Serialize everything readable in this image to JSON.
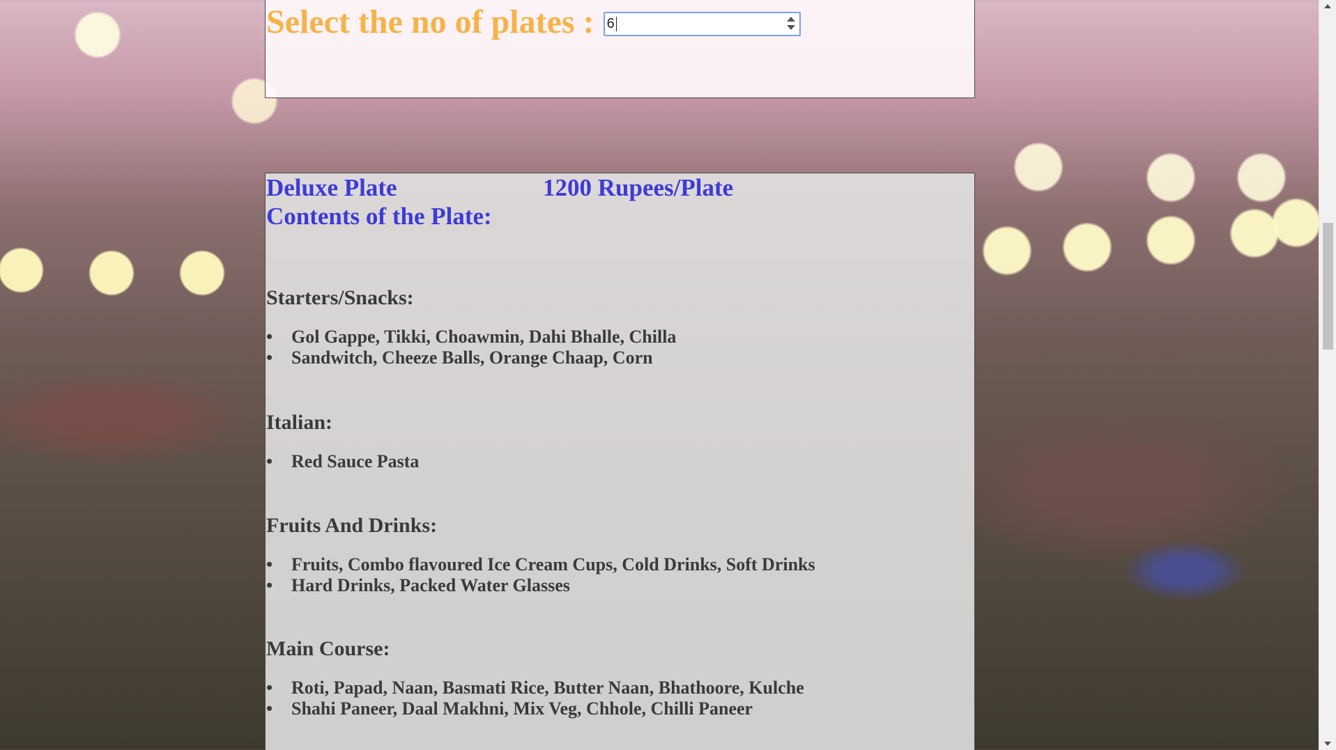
{
  "plates_selector": {
    "label": "Select the no of plates :",
    "value": "6"
  },
  "plate": {
    "name": "Deluxe Plate",
    "price": "1200 Rupees/Plate",
    "contents_heading": "Contents of the Plate:"
  },
  "menu": {
    "starters": {
      "title": "Starters/Snacks:",
      "items": [
        "Gol Gappe, Tikki, Choawmin, Dahi Bhalle, Chilla",
        "Sandwitch, Cheeze Balls, Orange Chaap, Corn"
      ]
    },
    "italian": {
      "title": "Italian:",
      "items": [
        "Red Sauce Pasta"
      ]
    },
    "fruits_drinks": {
      "title": "Fruits And Drinks:",
      "items": [
        "Fruits, Combo flavoured Ice Cream Cups, Cold Drinks, Soft Drinks",
        "Hard Drinks, Packed Water Glasses"
      ]
    },
    "main_course": {
      "title": "Main Course:",
      "items": [
        "Roti, Papad, Naan, Basmati Rice, Butter Naan, Bhathoore, Kulche",
        "Shahi Paneer, Daal Makhni, Mix Veg, Chhole, Chilli Paneer"
      ]
    }
  },
  "bullet_glyph": "•"
}
